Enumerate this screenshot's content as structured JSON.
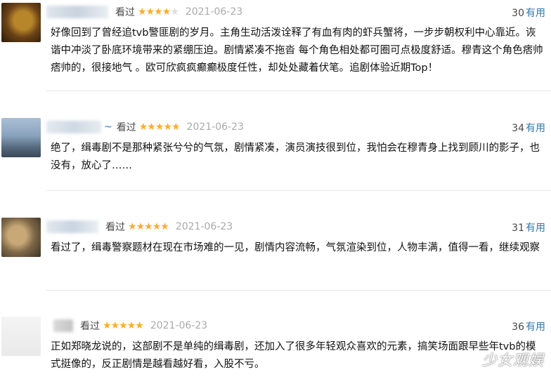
{
  "watched_label": "看过",
  "useful_label": "有用",
  "comments": [
    {
      "username_tail": "",
      "rating": 4,
      "date": "2021-06-23",
      "votes": "30",
      "text": "好像回到了曾经追tvb警匪剧的岁月。主角生动活泼诠释了有血有肉的虾兵蟹将，一步步朝权利中心靠近。诙谐中冲淡了卧底环境带来的紧绷压迫。剧情紧凑不拖沓 每个角色相处都可圈可点极度舒适。穆青这个角色痞帅痞帅的，很接地气 。欧可欣疯疯癫癫极度任性，却处处藏着伏笔。追剧体验近期Top！"
    },
    {
      "username_tail": "~",
      "rating": 5,
      "date": "2021-06-23",
      "votes": "34",
      "text": "绝了，缉毒剧不是那种紧张兮兮的气氛，剧情紧凑，演员演技很到位，我怕会在穆青身上找到顾川的影子，也没有，放心了……"
    },
    {
      "username_tail": "",
      "rating": 5,
      "date": "2021-06-23",
      "votes": "31",
      "text": "看过了，缉毒警察题材在现在市场难的一见，剧情内容流畅，气氛渲染到位，人物丰满，值得一看，继续观察"
    },
    {
      "username_tail": "",
      "rating": 5,
      "date": "2021-06-23",
      "votes": "36",
      "text": "正如郑晓龙说的，这部剧不是单纯的缉毒剧，还加入了很多年轻观众喜欢的元素，搞笑场面跟早些年tvb的模式挺像的，反正剧情是越看越好看，入股不亏。"
    }
  ],
  "watermark": "少女观娱",
  "colors": {
    "star": "#ffac2d",
    "link": "#3377aa",
    "date": "#aaaaaa",
    "text": "#111111"
  }
}
